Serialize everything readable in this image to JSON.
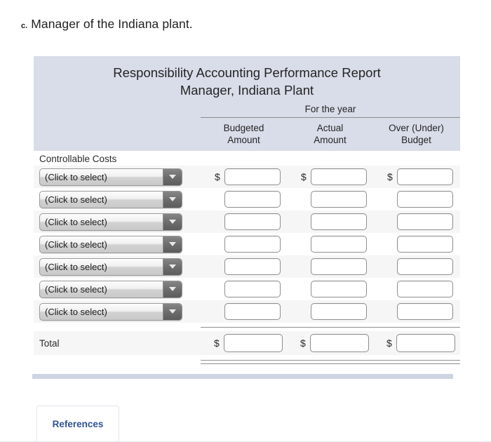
{
  "question": {
    "letter": "c.",
    "text": "Manager of the Indiana plant."
  },
  "report": {
    "title_line1": "Responsibility Accounting Performance Report",
    "title_line2": "Manager, Indiana Plant",
    "period": "For the year",
    "columns": [
      {
        "line1": "Budgeted",
        "line2": "Amount"
      },
      {
        "line1": "Actual",
        "line2": "Amount"
      },
      {
        "line1": "Over (Under)",
        "line2": "Budget"
      }
    ],
    "section_label": "Controllable Costs",
    "select_placeholder": "(Click to select)",
    "rows": [
      {
        "select": "(Click to select)",
        "budgeted": "",
        "actual": "",
        "over_under": "",
        "dollar": true
      },
      {
        "select": "(Click to select)",
        "budgeted": "",
        "actual": "",
        "over_under": "",
        "dollar": false
      },
      {
        "select": "(Click to select)",
        "budgeted": "",
        "actual": "",
        "over_under": "",
        "dollar": false
      },
      {
        "select": "(Click to select)",
        "budgeted": "",
        "actual": "",
        "over_under": "",
        "dollar": false
      },
      {
        "select": "(Click to select)",
        "budgeted": "",
        "actual": "",
        "over_under": "",
        "dollar": false
      },
      {
        "select": "(Click to select)",
        "budgeted": "",
        "actual": "",
        "over_under": "",
        "dollar": false
      },
      {
        "select": "(Click to select)",
        "budgeted": "",
        "actual": "",
        "over_under": "",
        "dollar": false
      }
    ],
    "total": {
      "label": "Total",
      "budgeted": "",
      "actual": "",
      "over_under": "",
      "currency_symbol": "$"
    },
    "currency_symbol": "$",
    "header_bg": "#d9dde9"
  },
  "tabs": {
    "references_label": "References",
    "accent_color": "#2f5496"
  }
}
